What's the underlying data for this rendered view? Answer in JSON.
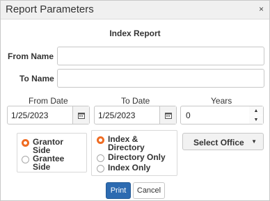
{
  "dialog": {
    "title": "Report Parameters",
    "close_glyph": "×",
    "report_name": "Index Report"
  },
  "fields": {
    "from_name": {
      "label": "From Name",
      "value": ""
    },
    "to_name": {
      "label": "To Name",
      "value": ""
    },
    "from_date": {
      "label": "From Date",
      "value": "1/25/2023"
    },
    "to_date": {
      "label": "To Date",
      "value": "1/25/2023"
    },
    "years": {
      "label": "Years",
      "value": "0"
    }
  },
  "side_options": [
    {
      "label_line1": "Grantor",
      "label_line2": "Side",
      "selected": true
    },
    {
      "label_line1": "Grantee",
      "label_line2": "Side",
      "selected": false
    }
  ],
  "index_options": [
    {
      "label_line1": "Index &",
      "label_line2": "Directory",
      "selected": true
    },
    {
      "label_line1": "Directory Only",
      "selected": false
    },
    {
      "label_line1": "Index Only",
      "selected": false
    }
  ],
  "office_dropdown": {
    "label": "Select Office",
    "caret": "▼"
  },
  "buttons": {
    "print": "Print",
    "cancel": "Cancel"
  },
  "colors": {
    "accent": "#ef6c23",
    "primary_button": "#2d6bb1"
  }
}
